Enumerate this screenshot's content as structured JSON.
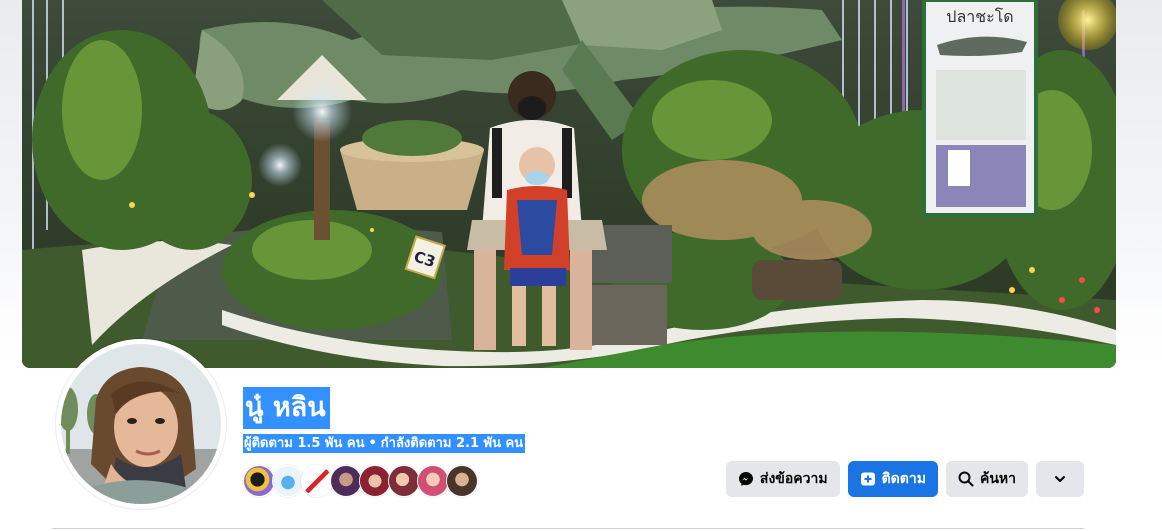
{
  "profile": {
    "name": "นู๋ หลิน",
    "followers_text": "ผู้ติดตาม 1.5 พัน คน",
    "separator": "•",
    "following_text": "กำลังติดตาม 2.1 พัน คน"
  },
  "cover": {
    "sign_text": "ปลาชะโด",
    "marker_text": "C3"
  },
  "actions": {
    "message_label": "ส่งข้อความ",
    "follow_label": "ติดตาม",
    "search_label": "ค้นหา",
    "message_icon": "messenger-icon",
    "follow_icon": "follow-plus-icon",
    "search_icon": "search-icon",
    "more_icon": "chevron-down-icon"
  },
  "colors": {
    "accent": "#1b74e4",
    "selection": "#3390ff",
    "button_grey": "#e4e6eb"
  }
}
